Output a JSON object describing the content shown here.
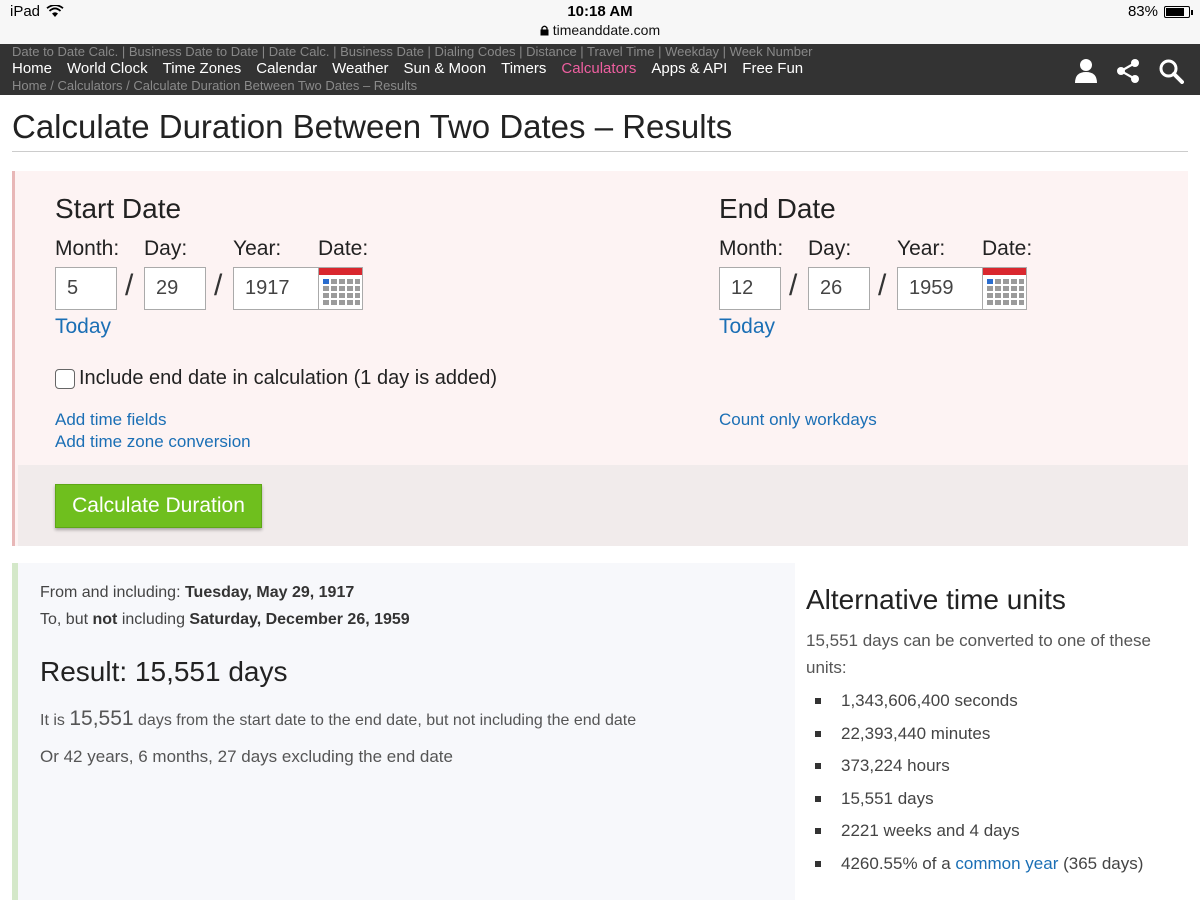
{
  "status": {
    "device": "iPad",
    "time": "10:18 AM",
    "url": "timeanddate.com",
    "battery": "83%",
    "battery_level": 0.83
  },
  "subnav": [
    "Date to Date Calc.",
    "Business Date to Date",
    "Date Calc.",
    "Business Date",
    "Dialing Codes",
    "Distance",
    "Travel Time",
    "Weekday",
    "Week Number"
  ],
  "nav": {
    "items": [
      "Home",
      "World Clock",
      "Time Zones",
      "Calendar",
      "Weather",
      "Sun & Moon",
      "Timers",
      "Calculators",
      "Apps & API",
      "Free Fun"
    ],
    "active": "Calculators"
  },
  "breadcrumb": {
    "home": "Home /",
    "calculators": "Calculators /",
    "current": "Calculate Duration Between Two Dates – Results"
  },
  "page": {
    "title": "Calculate Duration Between Two Dates – Results"
  },
  "form": {
    "start": {
      "heading": "Start Date",
      "month_label": "Month:",
      "day_label": "Day:",
      "year_label": "Year:",
      "date_label": "Date:",
      "month": "5",
      "day": "29",
      "year": "1917",
      "today": "Today"
    },
    "end": {
      "heading": "End Date",
      "month_label": "Month:",
      "day_label": "Day:",
      "year_label": "Year:",
      "date_label": "Date:",
      "month": "12",
      "day": "26",
      "year": "1959",
      "today": "Today"
    },
    "slash": "/",
    "include_end_label": "Include end date in calculation (1 day is added)",
    "include_end_checked": false,
    "add_time_fields": "Add time fields",
    "add_time_zone": "Add time zone conversion",
    "count_workdays": "Count only workdays",
    "calculate_button": "Calculate Duration"
  },
  "result": {
    "from_prefix": "From and including:",
    "from_date": "Tuesday, May 29, 1917",
    "to_prefix": "To, but",
    "to_not": "not",
    "to_including": "including",
    "to_date": "Saturday, December 26, 1959",
    "headline": "Result: 15,551 days",
    "desc_prefix": "It is",
    "desc_number": "15,551",
    "desc_suffix": "days from the start date to the end date, but not including the end date",
    "alt_summary": "Or 42 years, 6 months, 27 days excluding the end date"
  },
  "alternative": {
    "title": "Alternative time units",
    "intro": "15,551 days can be converted to one of these units:",
    "items": [
      "1,343,606,400 seconds",
      "22,393,440 minutes",
      "373,224 hours",
      "15,551 days",
      "2221 weeks and 4 days"
    ],
    "last_prefix": "4260.55% of a",
    "last_link": "common year",
    "last_suffix": "(365 days)"
  },
  "colors": {
    "nav_bg": "#333333",
    "nav_active": "#ee5fa0",
    "link": "#1b6fb5",
    "button": "#6fbf1e",
    "form_bg": "#fdf3f3"
  }
}
